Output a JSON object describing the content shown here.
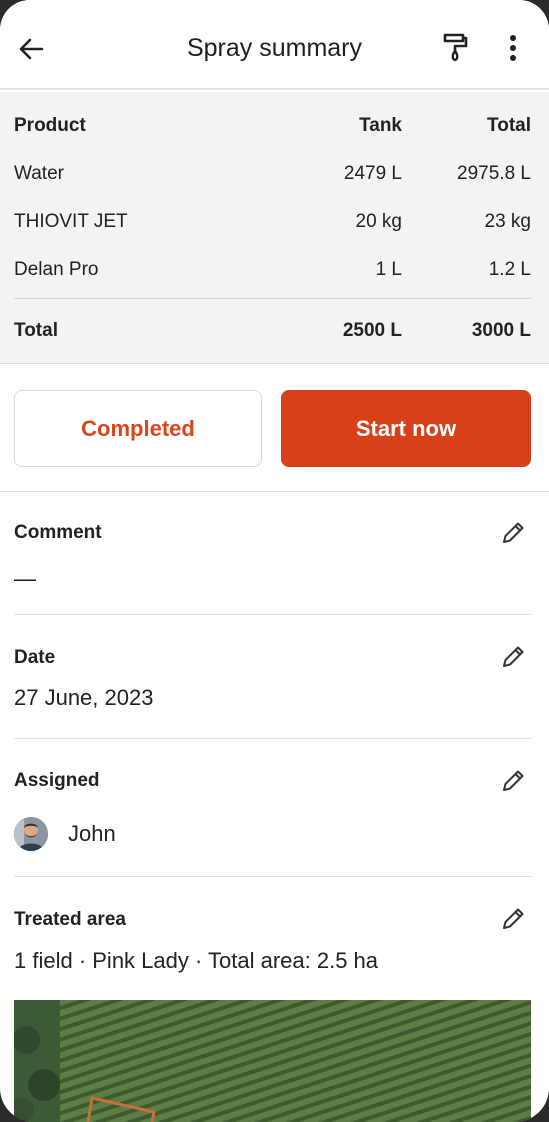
{
  "header": {
    "title": "Spray summary",
    "back_icon": "arrow-left-icon",
    "paint_icon": "paint-roller-icon",
    "more_icon": "more-vertical-icon"
  },
  "products": {
    "columns": [
      "Product",
      "Tank",
      "Total"
    ],
    "rows": [
      {
        "product": "Water",
        "tank": "2479 L",
        "total": "2975.8 L"
      },
      {
        "product": "THIOVIT JET",
        "tank": "20 kg",
        "total": "23 kg"
      },
      {
        "product": "Delan Pro",
        "tank": "1 L",
        "total": "1.2 L"
      }
    ],
    "total": {
      "label": "Total",
      "tank": "2500 L",
      "total": "3000 L"
    }
  },
  "actions": {
    "completed_label": "Completed",
    "start_label": "Start now"
  },
  "comment": {
    "label": "Comment",
    "value": "—"
  },
  "date": {
    "label": "Date",
    "value": "27 June, 2023"
  },
  "assigned": {
    "label": "Assigned",
    "name": "John"
  },
  "treated_area": {
    "label": "Treated area",
    "value": "1 field · Pink Lady ·  Total area: 2.5 ha"
  },
  "colors": {
    "accent": "#d8401a",
    "table_bg": "#f3f3f3"
  }
}
